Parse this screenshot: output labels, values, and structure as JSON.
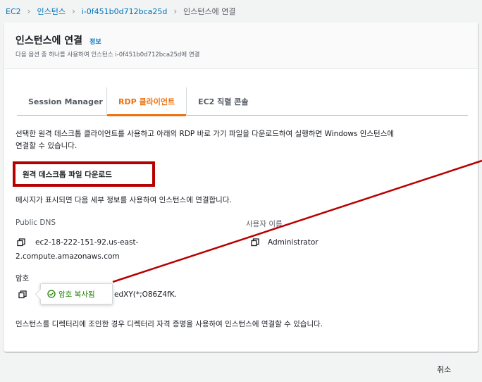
{
  "breadcrumb": {
    "items": [
      "EC2",
      "인스턴스",
      "i-0f451b0d712bca25d",
      "인스턴스에 연결"
    ]
  },
  "header": {
    "title": "인스턴스에 연결",
    "info_link": "정보",
    "subtitle": "다음 옵션 중 하나를 사용하여 인스턴스 i-0f451b0d712bca25d에 연결"
  },
  "tabs": [
    {
      "label": "Session Manager",
      "active": false
    },
    {
      "label": "RDP 클라이언트",
      "active": true
    },
    {
      "label": "EC2 직렬 콘솔",
      "active": false
    }
  ],
  "rdp": {
    "description_line1": "선택한 원격 데스크톱 클라이언트를 사용하고 아래의 RDP 바로 가기 파일을 다운로드하여 실행하면 Windows 인스턴스에",
    "description_line2": "연결할 수 있습니다.",
    "download_button": "원격 데스크톱 파일 다운로드",
    "prompt_text": "메시지가 표시되면 다음 세부 정보를 사용하여 인스턴스에 연결합니다.",
    "public_dns_label": "Public DNS",
    "public_dns_line1": "ec2-18-222-151-92.us-east-",
    "public_dns_line2": "2.compute.amazonaws.com",
    "username_label": "사용자 이름",
    "username_value": "Administrator",
    "password_label": "암호",
    "password_value_visible": "edXY(*;O86Z4fK.",
    "copied_tooltip": "암호 복사됨",
    "directory_note": "인스턴스를 디렉터리에 조인한 경우 디렉터리 자격 증명을 사용하여 인스턴스에 연결할 수 있습니다."
  },
  "footer": {
    "cancel_button": "취소"
  },
  "colors": {
    "link": "#0073bb",
    "active_tab": "#ec7211",
    "highlight_box": "#b70000",
    "success": "#1d8102"
  }
}
